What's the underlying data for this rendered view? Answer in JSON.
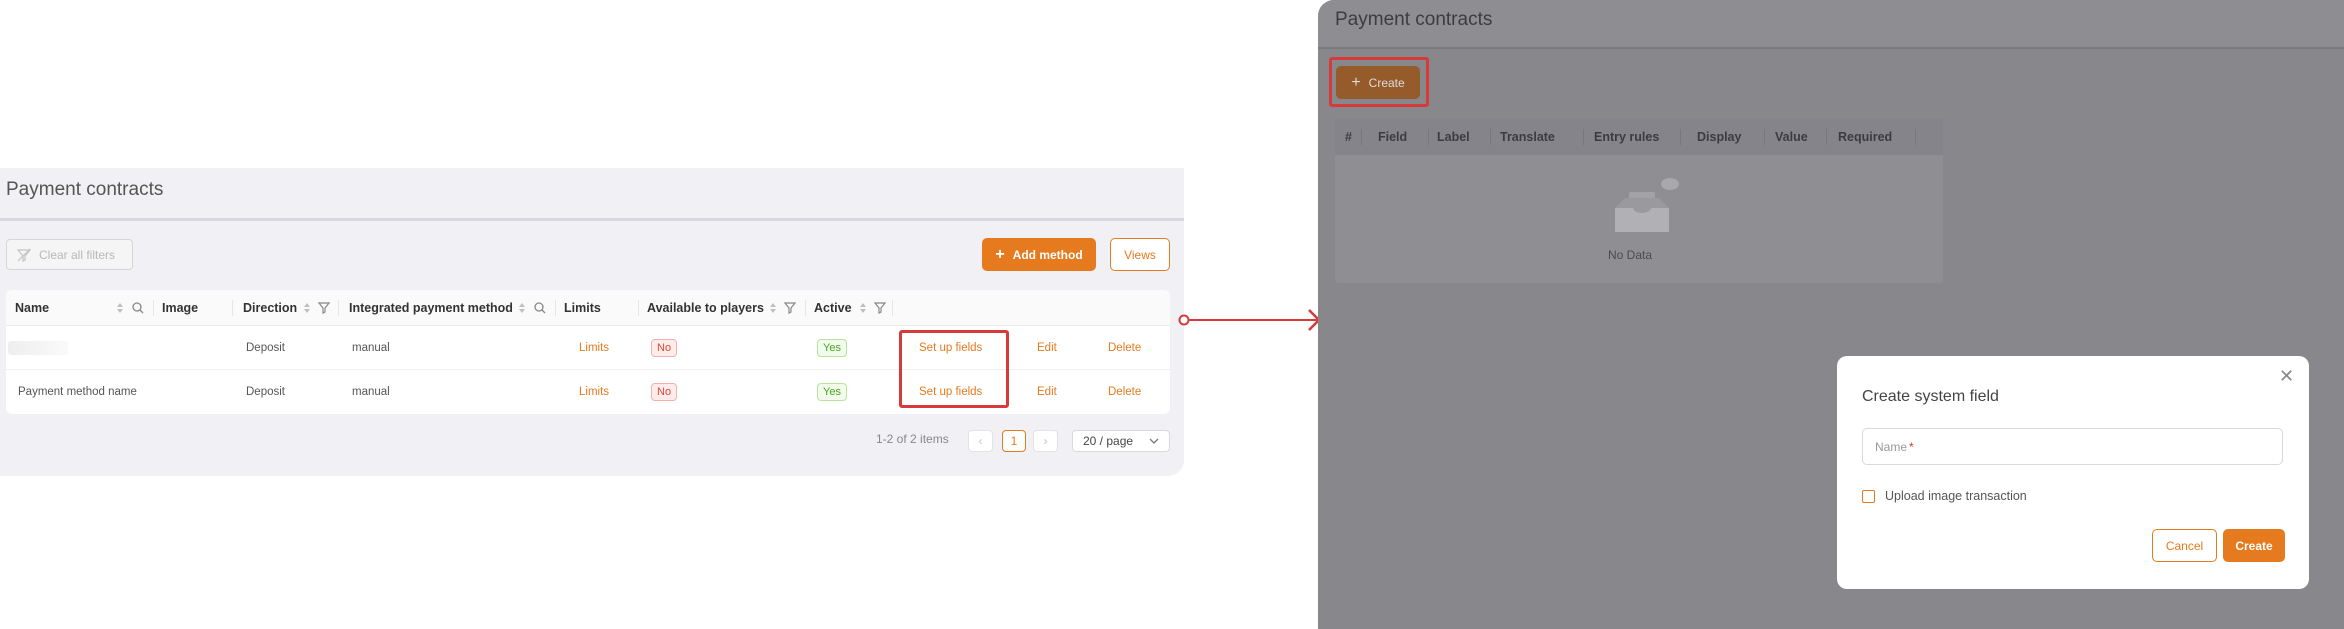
{
  "left": {
    "title": "Payment contracts",
    "clear_filters_label": "Clear all filters",
    "add_method_label": "Add method",
    "views_label": "Views",
    "columns": [
      "Name",
      "Image",
      "Direction",
      "Integrated payment method",
      "Limits",
      "Available to players",
      "Active"
    ],
    "rows": [
      {
        "name": "",
        "direction": "Deposit",
        "method": "manual",
        "limits": "Limits",
        "available": "No",
        "active": "Yes",
        "setup": "Set up fields",
        "edit": "Edit",
        "delete": "Delete"
      },
      {
        "name": "Payment method name",
        "direction": "Deposit",
        "method": "manual",
        "limits": "Limits",
        "available": "No",
        "active": "Yes",
        "setup": "Set up fields",
        "edit": "Edit",
        "delete": "Delete"
      }
    ],
    "pagination": {
      "total": "1-2 of 2 items",
      "current": "1",
      "page_size": "20 / page"
    }
  },
  "right": {
    "title": "Payment contracts",
    "create_label": "Create",
    "columns": [
      "#",
      "Field",
      "Label",
      "Translate",
      "Entry rules",
      "Display",
      "Value",
      "Required"
    ],
    "no_data": "No Data"
  },
  "modal": {
    "title": "Create system field",
    "name_placeholder": "Name",
    "required_mark": "*",
    "upload_label": "Upload image transaction",
    "cancel_label": "Cancel",
    "create_label": "Create"
  },
  "colors": {
    "accent": "#e57a1f",
    "highlight": "#d63a3a",
    "overlay": "#88878c"
  }
}
